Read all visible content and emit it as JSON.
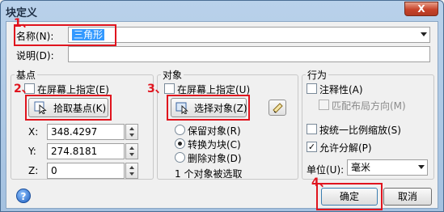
{
  "window": {
    "title": "块定义",
    "close_glyph": "X"
  },
  "name_field": {
    "label": "名称(N):",
    "value": "三角形"
  },
  "description_field": {
    "label": "说明(D):",
    "value": ""
  },
  "base_point": {
    "title": "基点",
    "specify_on_screen": "在屏幕上指定(E)",
    "pick_button": "拾取基点(K)",
    "x_label": "X:",
    "x_value": "348.4297",
    "y_label": "Y:",
    "y_value": "274.8181",
    "z_label": "Z:",
    "z_value": "0"
  },
  "objects": {
    "title": "对象",
    "specify_on_screen": "在屏幕上指定(U)",
    "select_button": "选择对象(Z)",
    "retain": "保留对象(R)",
    "convert": "转换为块(C)",
    "delete": "删除对象(D)",
    "status": "1 个对象被选取"
  },
  "behavior": {
    "title": "行为",
    "annotative": "注释性(A)",
    "match_orientation": "匹配布局方向(M)",
    "uniform_scale": "按统一比例缩放(S)",
    "allow_explode": "允许分解(P)",
    "units_label": "单位(U):",
    "units_value": "毫米"
  },
  "buttons": {
    "ok": "确定",
    "cancel": "取消",
    "help": "?"
  },
  "annotations": {
    "n1": "1、",
    "n2": "2、",
    "n3": "3、",
    "n4": "4、"
  },
  "colors": {
    "highlight": "#e0141e",
    "selection": "#3399ff"
  }
}
